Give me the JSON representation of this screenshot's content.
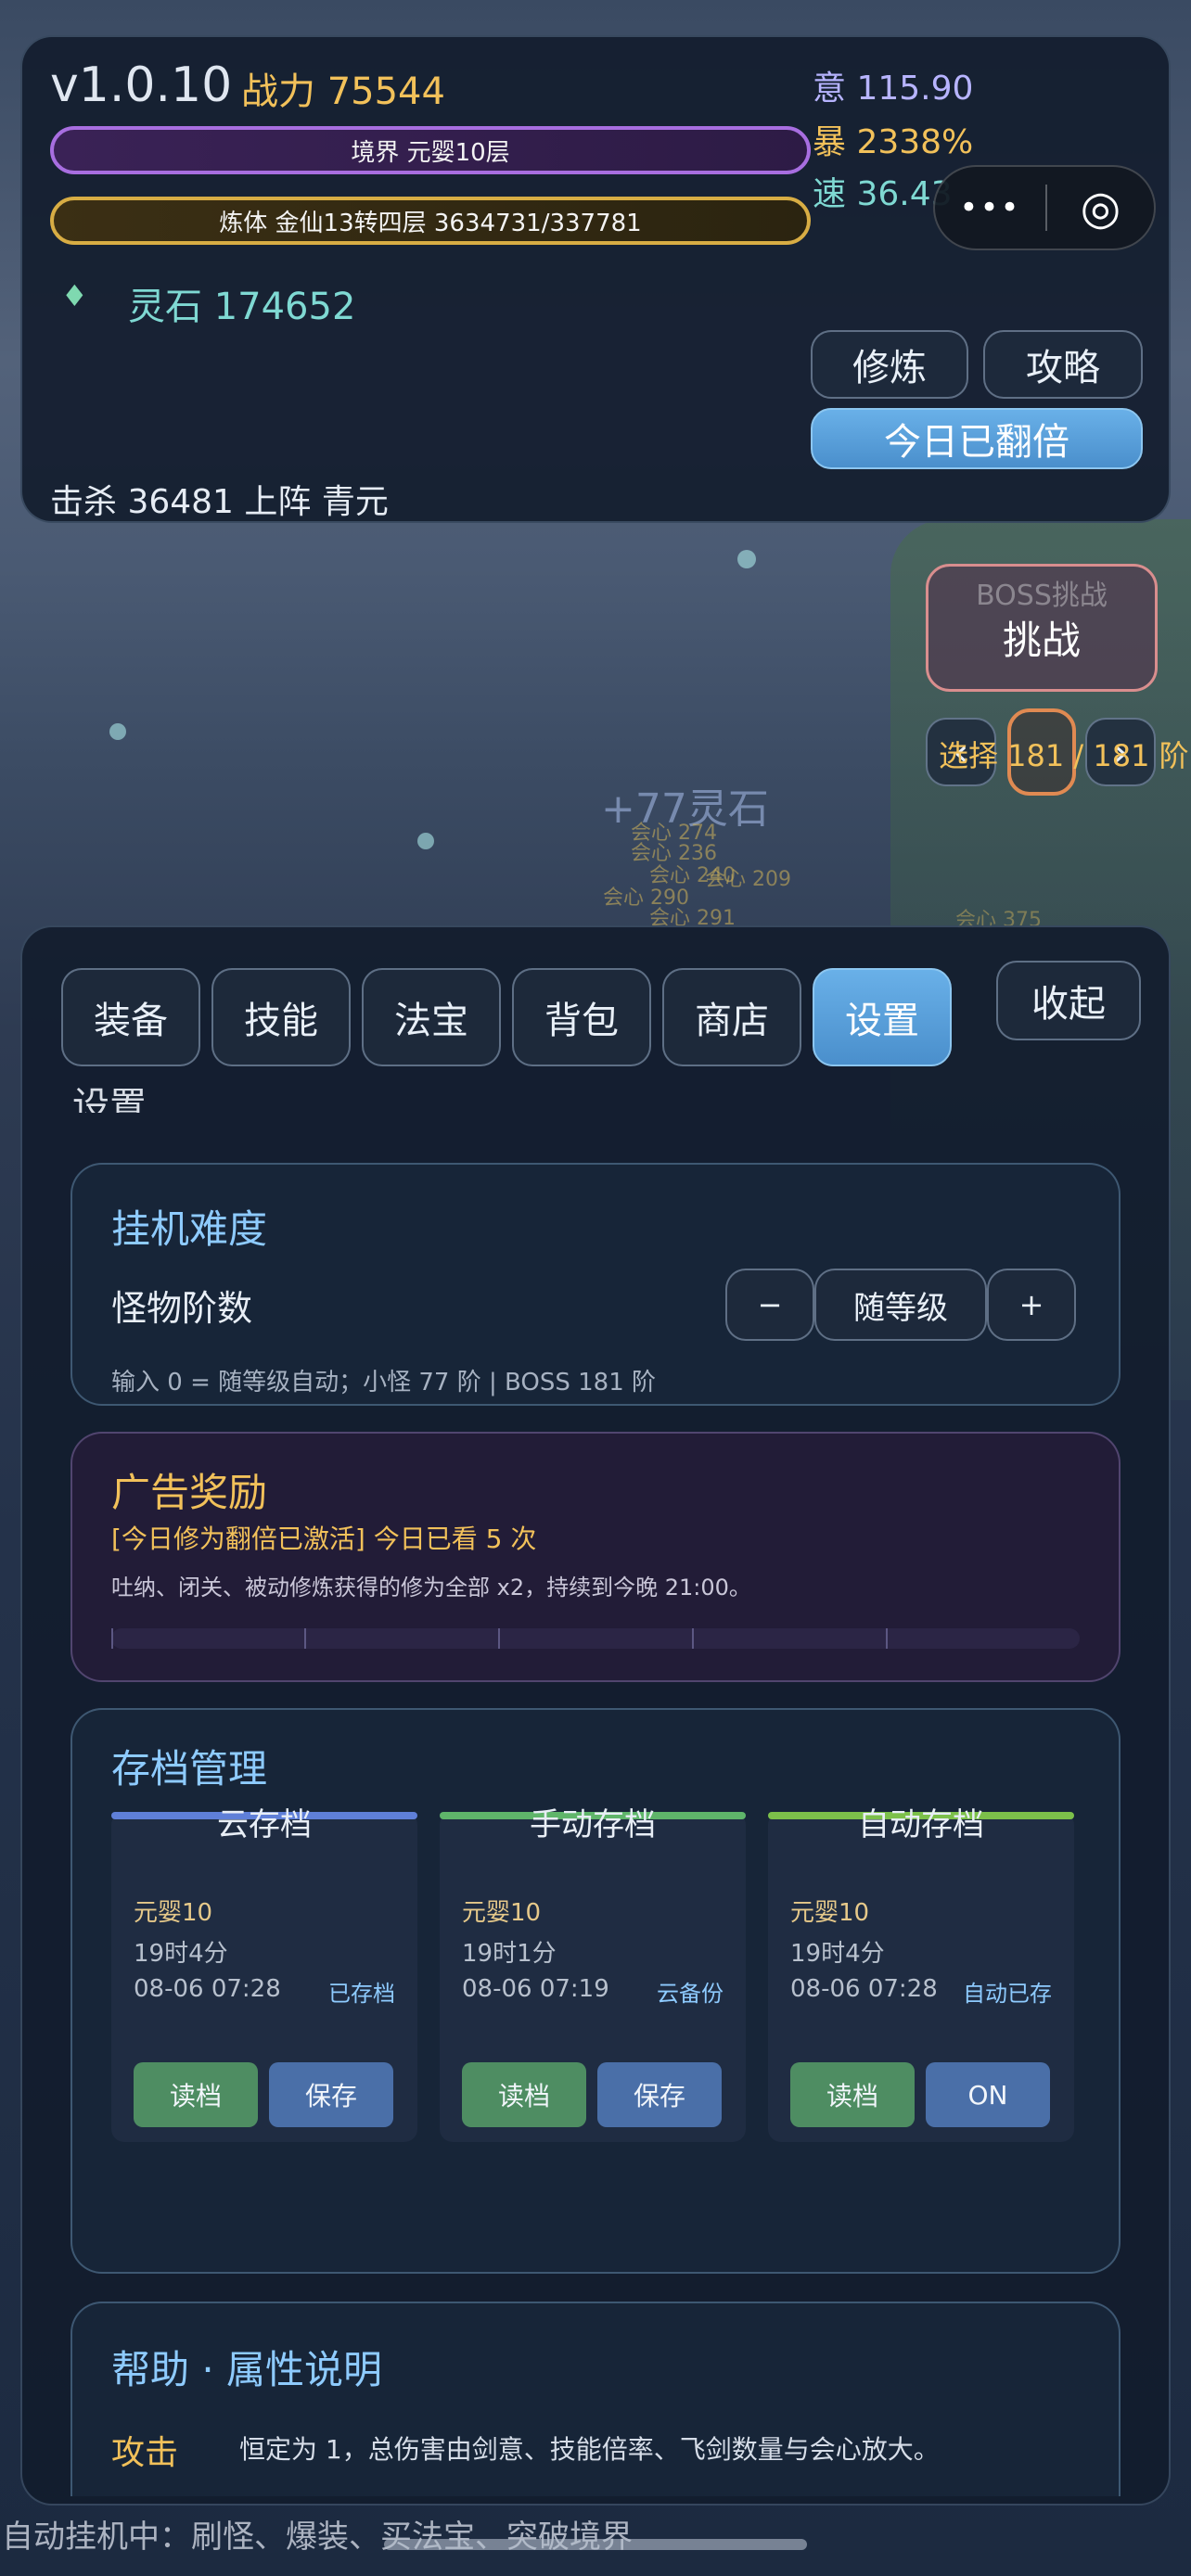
{
  "header": {
    "version": "v1.0.10",
    "power": "战力 75544",
    "realm_bar": "境界 元婴10层",
    "body_bar": "炼体 金仙13转四层  3634731/337781",
    "spirit_stones": "灵石 174652",
    "kills": "击杀 36481  上阵 青元",
    "stats": {
      "intent": "意 115.90",
      "crit": "暴 2338%",
      "speed": "速 36.43"
    },
    "cultivate_btn": "修炼",
    "guide_btn": "攻略",
    "double_btn": "今日已翻倍"
  },
  "capsule": {
    "more": "•••",
    "target": "◎"
  },
  "boss": {
    "title": "BOSS挑战",
    "challenge": "挑战",
    "select_label": "选择 181 / 181 阶",
    "prev": "‹",
    "next": "›"
  },
  "floating": {
    "gain": "+77灵石",
    "texts": [
      "会心 274",
      "会心 236",
      "会心 240",
      "会心 290",
      "会心 291",
      "会心 209",
      "会心 375"
    ]
  },
  "tabs": [
    "装备",
    "技能",
    "法宝",
    "背包",
    "商店",
    "设置"
  ],
  "active_tab": "设置",
  "collapse_btn": "收起",
  "section_title": "设置",
  "difficulty": {
    "title": "挂机难度",
    "label": "怪物阶数",
    "minus": "−",
    "value": "随等级",
    "plus": "+",
    "hint": "输入 0 = 随等级自动；小怪 77 阶 | BOSS 181 阶"
  },
  "ad": {
    "title": "广告奖励",
    "status": "[今日修为翻倍已激活] 今日已看 5 次",
    "desc": "吐纳、闭关、被动修炼获得的修为全部 x2，持续到今晚 21:00。",
    "progress": 0
  },
  "saves": {
    "title": "存档管理",
    "columns": [
      {
        "name": "云存档",
        "realm": "元婴10",
        "time": "19时4分",
        "date": "08-06 07:28",
        "status": "已存档",
        "btn1": "读档",
        "btn2": "保存",
        "color": "#5f7fd8"
      },
      {
        "name": "手动存档",
        "realm": "元婴10",
        "time": "19时1分",
        "date": "08-06 07:19",
        "status": "云备份",
        "btn1": "读档",
        "btn2": "保存",
        "color": "#5fb56a"
      },
      {
        "name": "自动存档",
        "realm": "元婴10",
        "time": "19时4分",
        "date": "08-06 07:28",
        "status": "自动已存",
        "btn1": "读档",
        "btn2": "ON",
        "color": "#7cc04a"
      }
    ]
  },
  "help": {
    "title": "帮助 · 属性说明",
    "attack_label": "攻击",
    "attack_desc": "恒定为 1，总伤害由剑意、技能倍率、飞剑数量与会心放大。"
  },
  "footer": "自动挂机中：刷怪、爆装、买法宝、突破境界",
  "colors": {
    "accent": "#5ea8e6",
    "gold": "#f2c15a",
    "realm": "#9b5bd6",
    "body": "#c9a33a"
  }
}
